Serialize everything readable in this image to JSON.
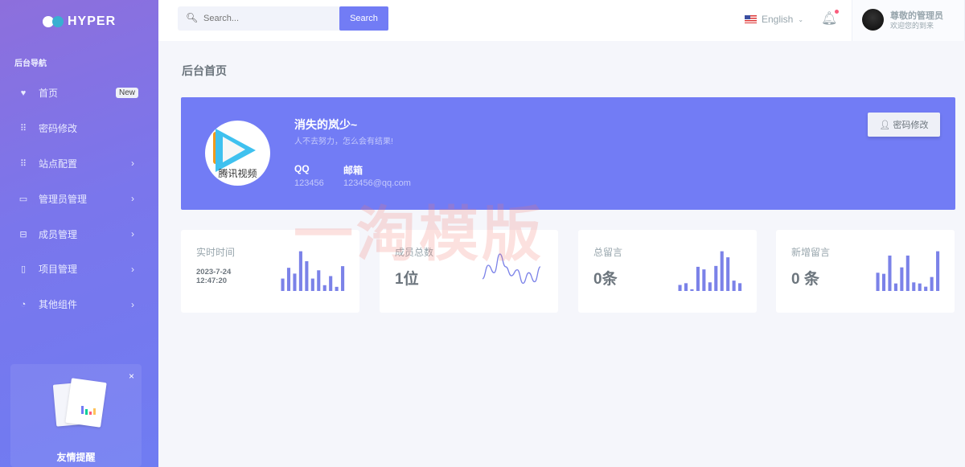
{
  "brand": "HYPER",
  "sidebar": {
    "section_title": "后台导航",
    "items": [
      {
        "label": "首页",
        "icon": "heart-icon",
        "badge": "New"
      },
      {
        "label": "密码修改",
        "icon": "grid-icon"
      },
      {
        "label": "站点配置",
        "icon": "grid-icon",
        "chevron": true
      },
      {
        "label": "管理员管理",
        "icon": "window-icon",
        "chevron": true
      },
      {
        "label": "成员管理",
        "icon": "briefcase-icon",
        "chevron": true
      },
      {
        "label": "项目管理",
        "icon": "document-icon",
        "chevron": true
      },
      {
        "label": "其他组件",
        "icon": "pie-icon",
        "chevron": true
      }
    ],
    "promo": {
      "title": "友情提醒",
      "close": "×"
    }
  },
  "header": {
    "search_placeholder": "Search...",
    "search_button": "Search",
    "language": "English",
    "user_name": "尊敬的管理员",
    "user_sub": "欢迎您的到来"
  },
  "page_title": "后台首页",
  "profile": {
    "name": "消失的岚少~",
    "motto": "人不去努力，怎么会有结果!",
    "logo_text": "腾讯视频",
    "qq_label": "QQ",
    "qq": "123456",
    "email_label": "邮箱",
    "email": "123456@qq.com",
    "button": "密码修改"
  },
  "watermark": "一淘模版",
  "stats": [
    {
      "label": "实时时间",
      "date": "2023-7-24",
      "time": "12:47:20",
      "spark_type": "bar",
      "spark": [
        15,
        28,
        21,
        48,
        36,
        15,
        25,
        7,
        18,
        5,
        30
      ]
    },
    {
      "label": "成员总数",
      "value": "1位",
      "spark_type": "line",
      "spark": [
        12,
        30,
        20,
        45,
        28,
        16,
        24,
        6,
        20,
        8,
        28
      ]
    },
    {
      "label": "总留言",
      "value": "0条",
      "spark_type": "bar",
      "spark": [
        7,
        9,
        2,
        28,
        25,
        10,
        29,
        46,
        39,
        12,
        9
      ]
    },
    {
      "label": "新增留言",
      "value": "0 条",
      "spark_type": "bar",
      "spark": [
        17,
        16,
        33,
        7,
        22,
        33,
        8,
        7,
        4,
        13,
        37
      ]
    }
  ],
  "colors": {
    "primary": "#727cf5",
    "spark": "#7b82e8"
  }
}
